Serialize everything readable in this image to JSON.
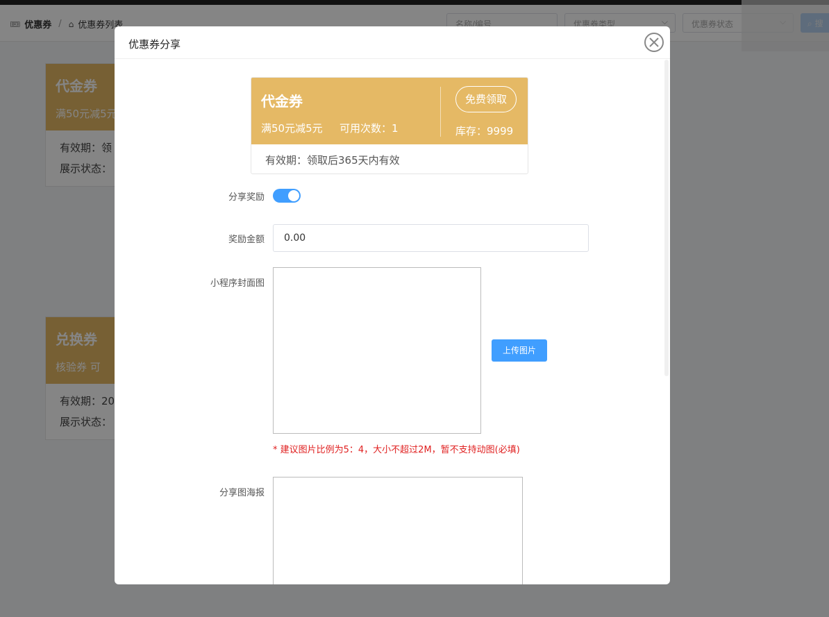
{
  "breadcrumb": {
    "root": "优惠券",
    "separator": "/",
    "current": "优惠券列表"
  },
  "filters": {
    "name_placeholder": "名称/编号",
    "type_placeholder": "优惠券类型",
    "status_placeholder": "优惠券状态",
    "search_label": "搜"
  },
  "bg_cards": [
    {
      "title": "代金券",
      "sub": "满50元减5元",
      "line1": "有效期：领",
      "line2": "展示状态："
    },
    {
      "title": "兑换券",
      "sub": "核验券   可",
      "line1": "有效期：20",
      "line2": "展示状态："
    }
  ],
  "modal": {
    "title": "优惠券分享",
    "coupon": {
      "name": "代金券",
      "rule": "满50元减5元",
      "uses": "可用次数：1",
      "claim_label": "免费领取",
      "stock": "库存：9999",
      "validity": "有效期：领取后365天内有效"
    },
    "share_reward_label": "分享奖励",
    "share_reward_on": true,
    "reward_amount_label": "奖励金额",
    "reward_amount_value": "0.00",
    "cover_label": "小程序封面图",
    "upload_label": "上传图片",
    "hint": "* 建议图片比例为5：4，大小不超过2M，暂不支持动图(必填)",
    "poster_label": "分享图海报"
  },
  "colors": {
    "coupon_gold": "#e5b965",
    "primary_blue": "#409eff",
    "hint_red": "#e02020"
  }
}
